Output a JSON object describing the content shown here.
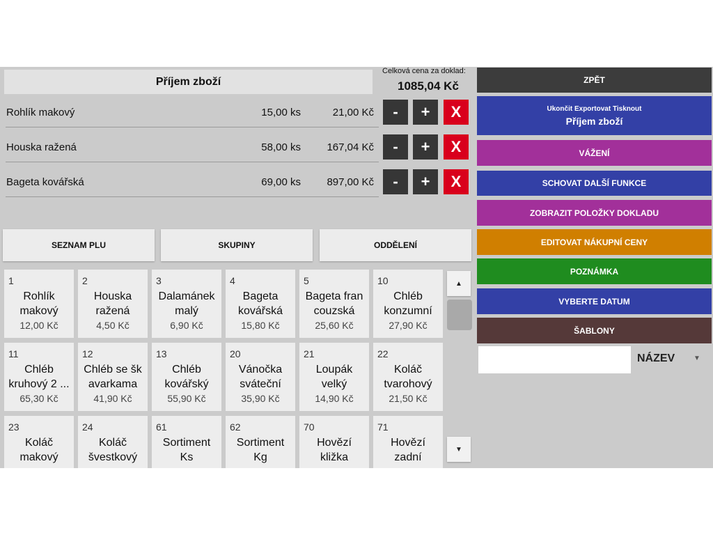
{
  "document": {
    "title": "Příjem zboží",
    "total_label": "Celková cena za doklad:",
    "total_value": "1085,04 Kč",
    "lines": [
      {
        "name": "Rohlík makový",
        "qty": "15,00 ks",
        "price": "21,00 Kč"
      },
      {
        "name": "Houska ražená",
        "qty": "58,00 ks",
        "price": "167,04 Kč"
      },
      {
        "name": "Bageta kovářská",
        "qty": "69,00 ks",
        "price": "897,00 Kč"
      }
    ],
    "minus_label": "-",
    "plus_label": "+",
    "remove_label": "X"
  },
  "tabs": [
    "SEZNAM PLU",
    "SKUPINY",
    "ODDĚLENÍ"
  ],
  "products": [
    {
      "code": "1",
      "line1": "Rohlík",
      "line2": "makový",
      "price": "12,00 Kč"
    },
    {
      "code": "2",
      "line1": "Houska",
      "line2": "ražená",
      "price": "4,50 Kč"
    },
    {
      "code": "3",
      "line1": "Dalamánek",
      "line2": "malý",
      "price": "6,90 Kč"
    },
    {
      "code": "4",
      "line1": "Bageta",
      "line2": "kovářská",
      "price": "15,80 Kč"
    },
    {
      "code": "5",
      "line1": "Bageta fran",
      "line2": "couzská",
      "price": "25,60 Kč"
    },
    {
      "code": "10",
      "line1": "Chléb",
      "line2": "konzumní",
      "price": "27,90 Kč"
    },
    {
      "code": "11",
      "line1": "Chléb",
      "line2": "kruhový 2 ...",
      "price": "65,30 Kč"
    },
    {
      "code": "12",
      "line1": "Chléb se šk",
      "line2": "avarkama",
      "price": "41,90 Kč"
    },
    {
      "code": "13",
      "line1": "Chléb",
      "line2": "kovářský",
      "price": "55,90 Kč"
    },
    {
      "code": "20",
      "line1": "Vánočka",
      "line2": "sváteční",
      "price": "35,90 Kč"
    },
    {
      "code": "21",
      "line1": "Loupák",
      "line2": "velký",
      "price": "14,90 Kč"
    },
    {
      "code": "22",
      "line1": "Koláč",
      "line2": "tvarohový",
      "price": "21,50 Kč"
    },
    {
      "code": "23",
      "line1": "Koláč",
      "line2": "makový",
      "price": ""
    },
    {
      "code": "24",
      "line1": "Koláč",
      "line2": "švestkový",
      "price": ""
    },
    {
      "code": "61",
      "line1": "Sortiment",
      "line2": "Ks",
      "price": ""
    },
    {
      "code": "62",
      "line1": "Sortiment",
      "line2": "Kg",
      "price": ""
    },
    {
      "code": "70",
      "line1": "Hovězí",
      "line2": "kližka",
      "price": ""
    },
    {
      "code": "71",
      "line1": "Hovězí",
      "line2": "zadní",
      "price": ""
    }
  ],
  "scroll": {
    "up_label": "▲",
    "down_label": "▼"
  },
  "right_panel": {
    "back": "ZPĚT",
    "finish_sub": "Ukončit Exportovat Tisknout",
    "finish_main": "Příjem zboží",
    "weighing": "VÁŽENÍ",
    "hide_functions": "SCHOVAT DALŠÍ FUNKCE",
    "show_items": "ZOBRAZIT POLOŽKY DOKLADU",
    "edit_prices": "EDITOVAT NÁKUPNÍ CENY",
    "note": "POZNÁMKA",
    "choose_date": "VYBERTE DATUM",
    "templates": "ŠABLONY",
    "search_value": "",
    "sort_label": "NÁZEV",
    "sort_caret": "▼"
  },
  "colors": {
    "dark": "#3c3c3c",
    "blue": "#3340a6",
    "purple": "#a2309a",
    "orange": "#d07f00",
    "green": "#1f8c1f",
    "brown": "#553939",
    "red": "#d9001c"
  }
}
